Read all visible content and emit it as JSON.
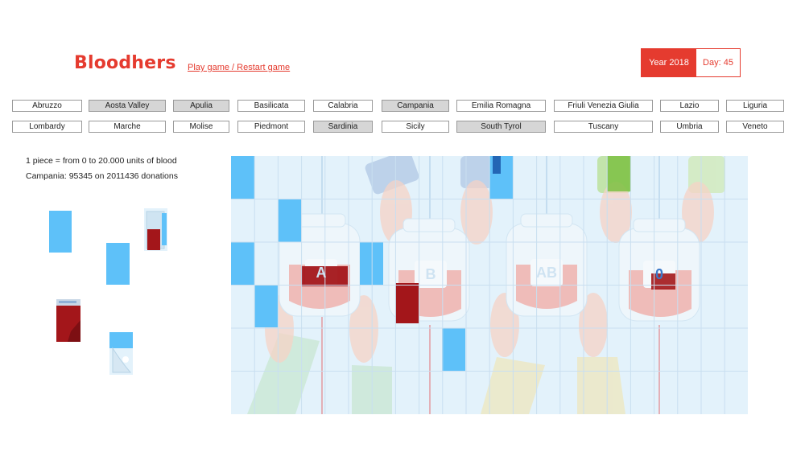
{
  "header": {
    "logo": "Bloodhers",
    "play_link": "Play game / Restart game",
    "year_label": "Year 2018",
    "day_label": "Day: 45"
  },
  "regions": {
    "row1": [
      {
        "name": "Abruzzo",
        "selected": false
      },
      {
        "name": "Aosta Valley",
        "selected": true
      },
      {
        "name": "Apulia",
        "selected": true
      },
      {
        "name": "Basilicata",
        "selected": false
      },
      {
        "name": "Calabria",
        "selected": false
      },
      {
        "name": "Campania",
        "selected": true
      },
      {
        "name": "Emilia Romagna",
        "selected": false
      },
      {
        "name": "Friuli Venezia Giulia",
        "selected": false
      },
      {
        "name": "Lazio",
        "selected": false
      },
      {
        "name": "Liguria",
        "selected": false
      }
    ],
    "row2": [
      {
        "name": "Lombardy",
        "selected": false
      },
      {
        "name": "Marche",
        "selected": false
      },
      {
        "name": "Molise",
        "selected": false
      },
      {
        "name": "Piedmont",
        "selected": false
      },
      {
        "name": "Sardinia",
        "selected": true
      },
      {
        "name": "Sicily",
        "selected": false
      },
      {
        "name": "South Tyrol",
        "selected": true
      },
      {
        "name": "Tuscany",
        "selected": false
      },
      {
        "name": "Umbria",
        "selected": false
      },
      {
        "name": "Veneto",
        "selected": false
      }
    ]
  },
  "info": {
    "legend": "1 piece = from 0 to 20.000 units of blood",
    "summary": "Campania: 95345 on 2011436 donations"
  },
  "bags": [
    {
      "type": "A"
    },
    {
      "type": "B"
    },
    {
      "type": "AB"
    },
    {
      "type": "0"
    }
  ],
  "colors": {
    "accent": "#e53b2f",
    "piece_blue": "#5ec1f9",
    "blood_red": "#a3161a",
    "board_bg": "#e3f2fb"
  }
}
